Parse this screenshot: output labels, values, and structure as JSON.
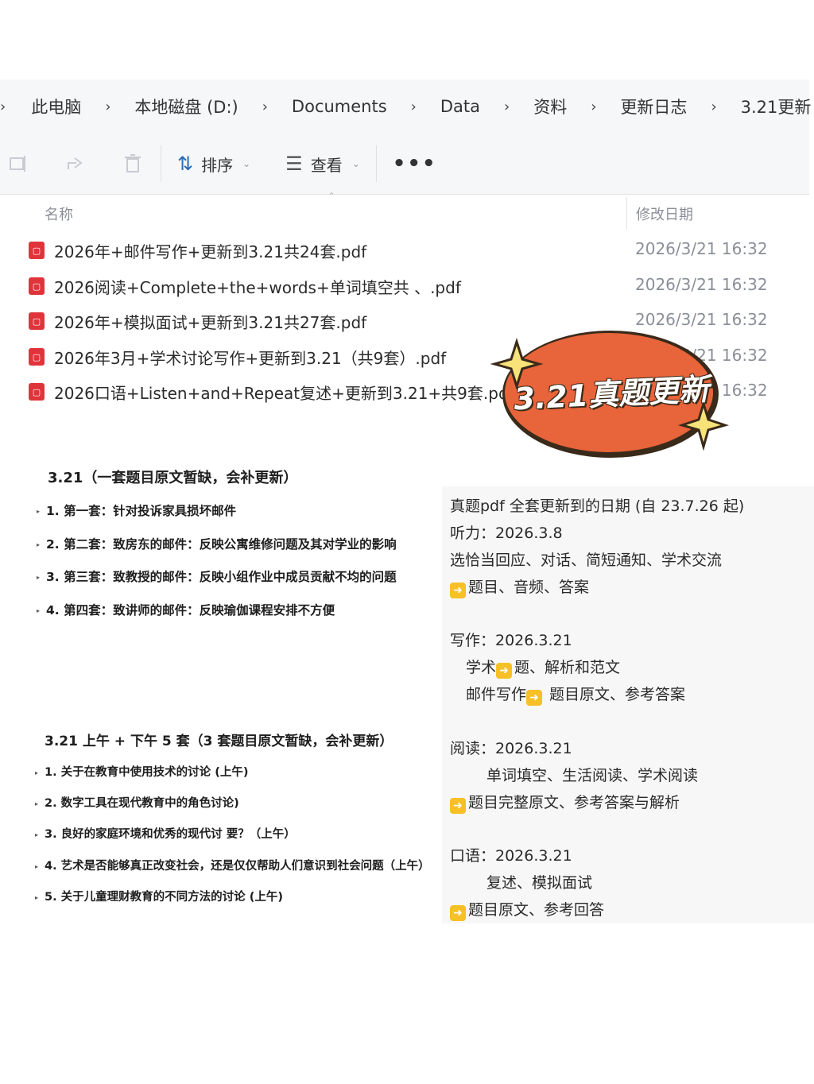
{
  "breadcrumb": [
    "此电脑",
    "本地磁盘 (D:)",
    "Documents",
    "Data",
    "资料",
    "更新日志",
    "3.21更新"
  ],
  "toolbar": {
    "sort_label": "排序",
    "view_label": "查看",
    "more_label": "•••"
  },
  "columns": {
    "name": "名称",
    "date": "修改日期"
  },
  "files": [
    {
      "name": "2026年+邮件写作+更新到3.21共24套.pdf",
      "date": "2026/3/21 16:32"
    },
    {
      "name": "2026阅读+Complete+the+words+单词填空共                      、.pdf",
      "date": "2026/3/21 16:32"
    },
    {
      "name": "2026年+模拟面试+更新到3.21共27套.pdf",
      "date": "2026/3/21 16:32"
    },
    {
      "name": "2026年3月+学术讨论写作+更新到3.21（共9套）.pdf",
      "date": "2026/3/21 16:32"
    },
    {
      "name": "2026口语+Listen+and+Repeat复述+更新到3.21+共9套.pdf",
      "date": "2026/3/21 16:32"
    }
  ],
  "sticker": {
    "text": "3.21真题更新",
    "fill": "#e8643a",
    "star": "#f8e37a"
  },
  "section1": {
    "title": "3.21（一套题目原文暂缺，会补更新）",
    "items": [
      "1. 第一套：针对投诉家具损坏邮件",
      "2. 第二套：致房东的邮件：反映公寓维修问题及其对学业的影响",
      "3. 第三套：致教授的邮件：反映小组作业中成员贡献不均的问题",
      "4. 第四套：致讲师的邮件：反映瑜伽课程安排不方便"
    ]
  },
  "section2": {
    "title": "3.21 上午 + 下午 5 套（3 套题目原文暂缺，会补更新）",
    "items": [
      "1. 关于在教育中使用技术的讨论 (上午)",
      "2. 数字工具在现代教育中的角色讨论)",
      "3. 良好的家庭环境和优秀的现代讨              要？（上午）",
      "4. 艺术是否能够真正改变社会，还是仅仅帮助人们意识到社会问题（上午）",
      "5. 关于儿童理财教育的不同方法的讨论 (上午)"
    ]
  },
  "info": {
    "heading": "真题pdf 全套更新到的日期 (自 23.7.26 起)",
    "listening_date": "听力：2026.3.8",
    "listening_types": "选恰当回应、对话、简短通知、学术交流",
    "listening_contents": "题目、音频、答案",
    "writing_date": "写作：2026.3.21",
    "writing_academic_a": "学术",
    "writing_academic_b": "题、解析和范文",
    "writing_email_a": "邮件写作",
    "writing_email_b": " 题目原文、参考答案",
    "reading_date": "阅读：2026.3.21",
    "reading_types": "单词填空、生活阅读、学术阅读",
    "reading_contents": "题目完整原文、参考答案与解析",
    "speaking_date": "口语：2026.3.21",
    "speaking_types": "复述、模拟面试",
    "speaking_contents": "题目原文、参考回答"
  }
}
